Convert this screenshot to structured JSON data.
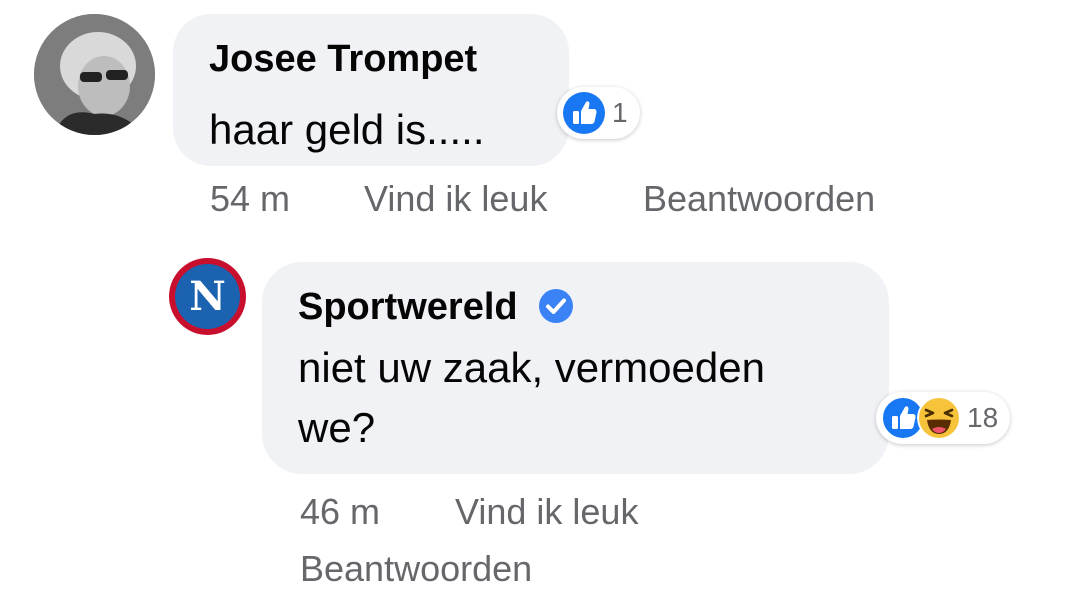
{
  "comment": {
    "author": "Josee Trompet",
    "text": "haar geld is.....",
    "reactions": {
      "icons": [
        "like-icon"
      ],
      "count": "1"
    },
    "time": "54 m",
    "like_label": "Vind ik leuk",
    "reply_label": "Beantwoorden"
  },
  "reply": {
    "avatar_letter": "N",
    "author": "Sportwereld",
    "verified": true,
    "text_line1": "niet uw zaak, vermoeden",
    "text_line2": "we?",
    "reactions": {
      "icons": [
        "like-icon",
        "haha-icon"
      ],
      "count": "18"
    },
    "time": "46 m",
    "like_label": "Vind ik leuk",
    "reply_label": "Beantwoorden"
  },
  "colors": {
    "bubble": "#f0f2f5",
    "meta_text": "#65676b",
    "like_blue": "#1877f2",
    "verified_blue": "#3b82f6",
    "logo_red": "#c8102e",
    "logo_blue": "#1b62b0"
  }
}
